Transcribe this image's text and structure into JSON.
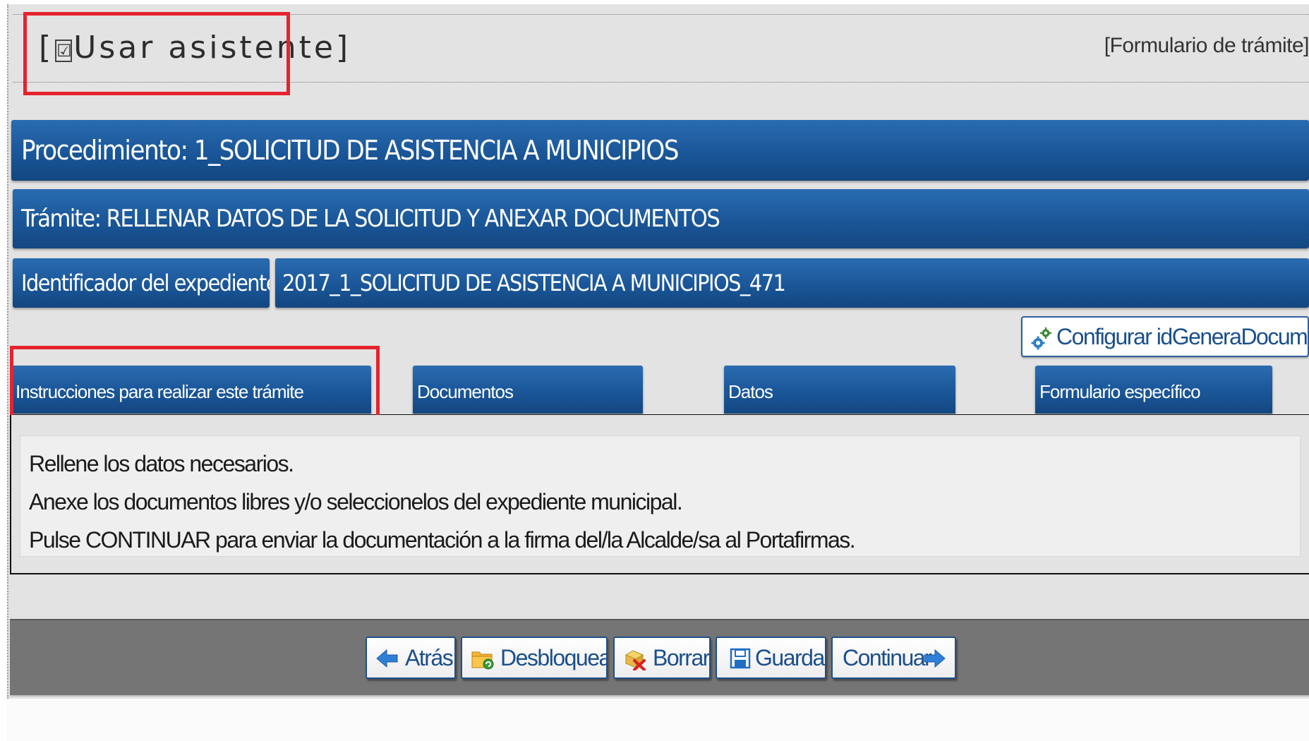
{
  "header": {
    "wizard_label": "Usar asistente",
    "wizard_bracket_open": "[",
    "wizard_bracket_close": "]",
    "wizard_checkbox": "☑",
    "form_link": "[Formulario de trámite]"
  },
  "procedure": {
    "label": "Procedimiento: 1_SOLICITUD DE ASISTENCIA A MUNICIPIOS"
  },
  "task": {
    "label": "Trámite: RELLENAR DATOS DE LA SOLICITUD Y ANEXAR DOCUMENTOS"
  },
  "record": {
    "label": "Identificador del expediente:",
    "value": "2017_1_SOLICITUD DE ASISTENCIA A MUNICIPIOS_471"
  },
  "config_button": {
    "label": "Configurar idGeneraDocumento",
    "icon": "gears-icon"
  },
  "tabs": [
    {
      "label": "Instrucciones para realizar este trámite",
      "active": true
    },
    {
      "label": "Documentos",
      "active": false
    },
    {
      "label": "Datos",
      "active": false
    },
    {
      "label": "Formulario específico",
      "active": false
    }
  ],
  "instructions": {
    "lines": [
      "Rellene los datos necesarios.",
      "Anexe los documentos libres y/o seleccionelos del expediente municipal.",
      "Pulse CONTINUAR para enviar la documentación a la firma del/la Alcalde/sa al Portafirmas."
    ]
  },
  "actions": {
    "back": {
      "label": "Atrás",
      "icon": "arrow-left-icon"
    },
    "unlock": {
      "label": "Desbloquear",
      "icon": "folder-unlock-icon"
    },
    "delete": {
      "label": "Borrar",
      "icon": "delete-icon"
    },
    "save": {
      "label": "Guardar",
      "icon": "save-icon"
    },
    "continue": {
      "label": "Continuar",
      "icon": "arrow-right-icon"
    }
  },
  "colors": {
    "bar_blue": "#1a5698",
    "highlight_red": "#e5232e",
    "action_bar_gray": "#757575",
    "panel_gray": "#e3e3e3"
  }
}
